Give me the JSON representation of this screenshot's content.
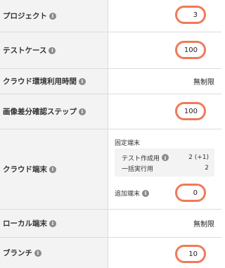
{
  "rows": {
    "project": {
      "label": "プロジェクト",
      "value": "3"
    },
    "testcase": {
      "label": "テストケース",
      "value": "100"
    },
    "cloud_time": {
      "label": "クラウド環境利用時間",
      "value": "無制限"
    },
    "image_diff": {
      "label": "画像差分確認ステップ",
      "value": "100"
    },
    "cloud_device": {
      "label": "クラウド端末",
      "fixed_heading": "固定端末",
      "fixed_items": [
        {
          "label": "テスト作成用",
          "info_icon": true,
          "value": "2 (+1)"
        },
        {
          "label": "一括実行用",
          "value": "2"
        }
      ],
      "additional_label": "追加端末",
      "additional_value": "0"
    },
    "local_device": {
      "label": "ローカル端末",
      "value": "無制限"
    },
    "branch": {
      "label": "ブランチ",
      "value": "10"
    }
  },
  "colors": {
    "highlight": "#ef7a58",
    "label_bg": "#f3f3f3",
    "border": "#dcdcdc",
    "info_icon": "#8a8a8a"
  },
  "icons": {
    "info": "info-icon"
  }
}
